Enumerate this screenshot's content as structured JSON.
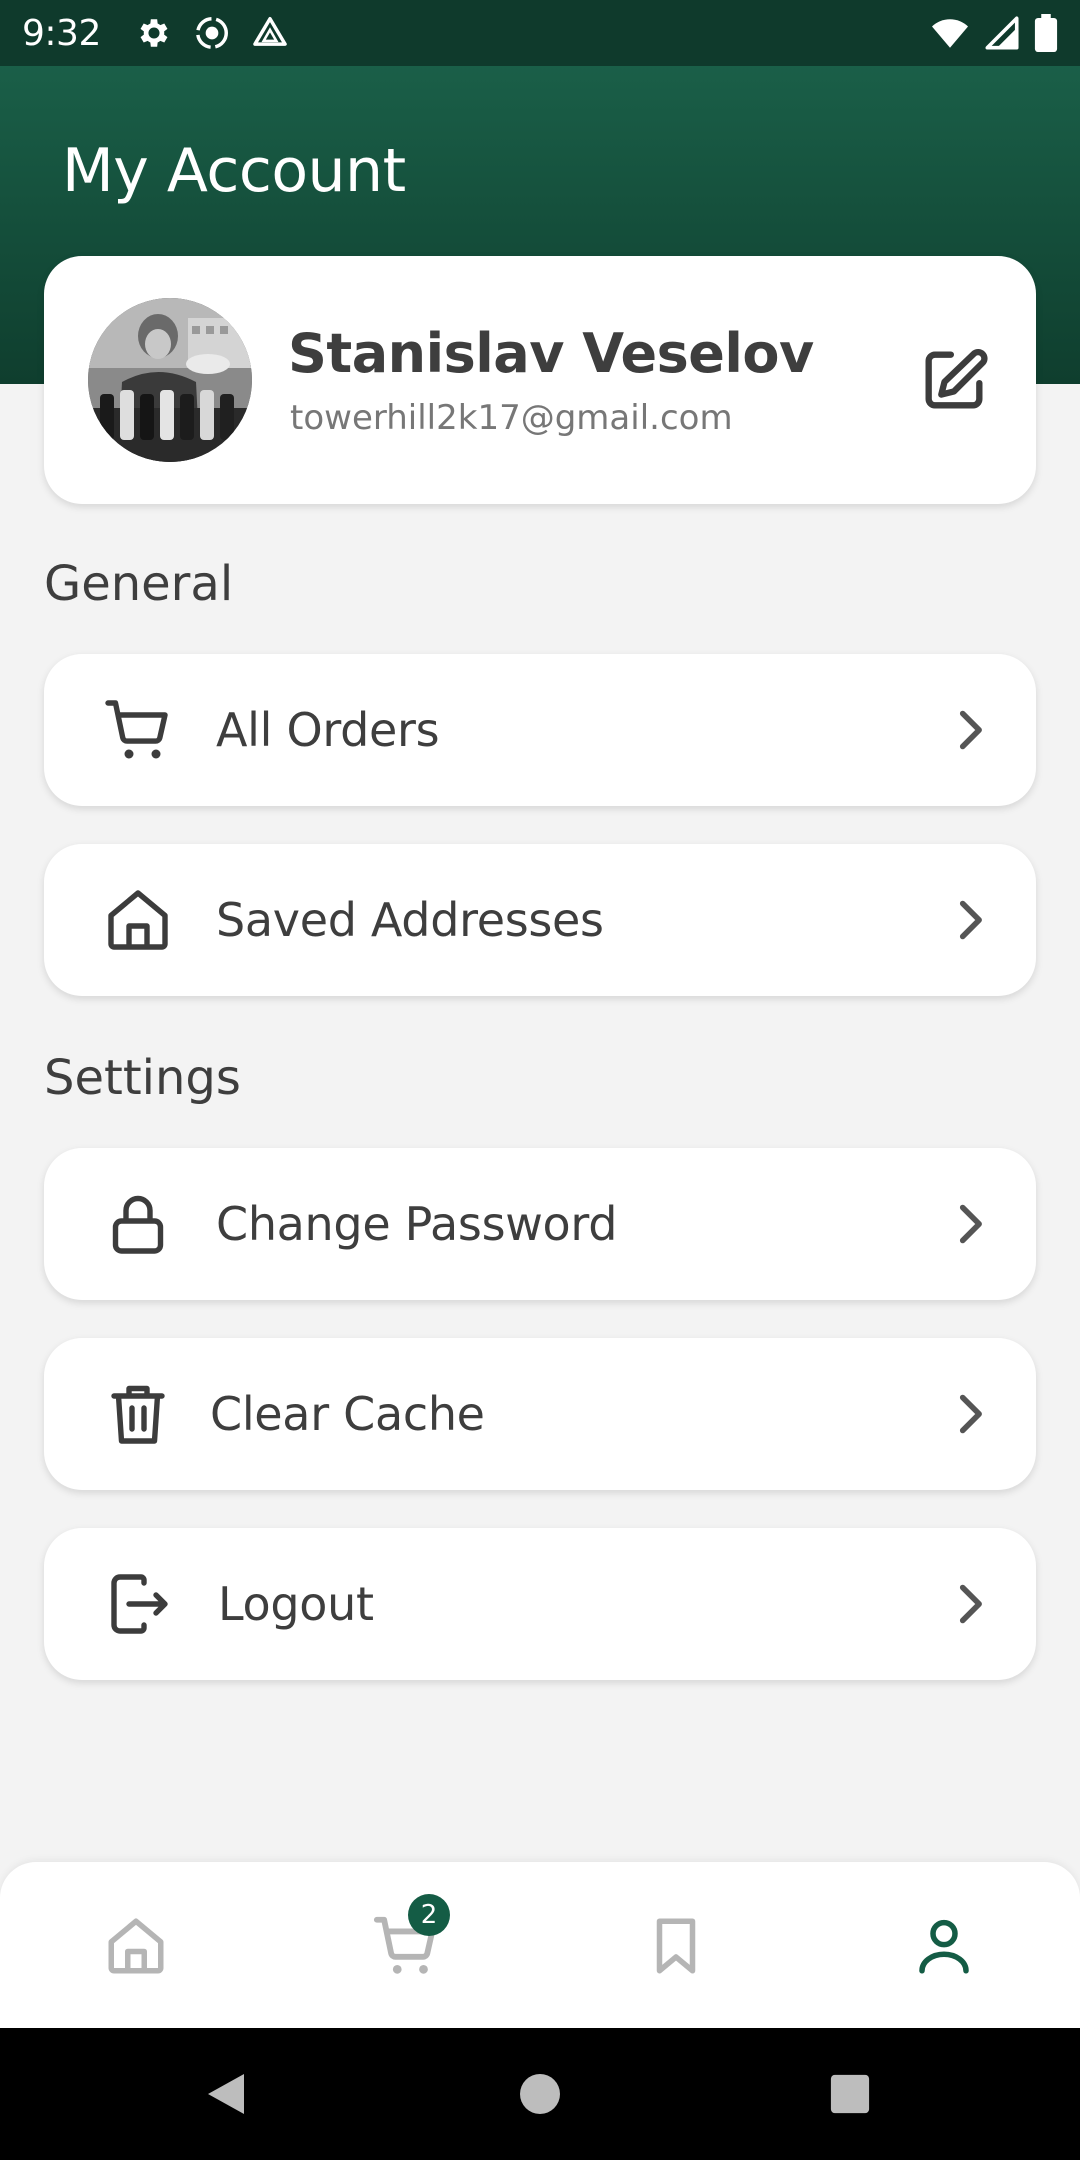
{
  "status_bar": {
    "time": "9:32",
    "left_icons": [
      "gear-icon",
      "record-icon",
      "drive-icon"
    ],
    "right_icons": [
      "wifi-icon",
      "signal-icon",
      "battery-icon"
    ]
  },
  "header": {
    "title": "My Account",
    "color": "#145c45"
  },
  "profile": {
    "name": "Stanislav Veselov",
    "email": "towerhill2k17@gmail.com",
    "avatar_icon": "avatar-photo",
    "edit_icon": "edit-icon"
  },
  "sections": {
    "general": {
      "title": "General",
      "items": [
        {
          "label": "All Orders",
          "icon": "cart-icon"
        },
        {
          "label": "Saved Addresses",
          "icon": "home-icon"
        }
      ]
    },
    "settings": {
      "title": "Settings",
      "items": [
        {
          "label": "Change Password",
          "icon": "lock-icon"
        },
        {
          "label": "Clear Cache",
          "icon": "trash-icon"
        },
        {
          "label": "Logout",
          "icon": "logout-icon"
        }
      ]
    }
  },
  "bottom_nav": {
    "items": [
      {
        "icon": "home-icon",
        "active": false
      },
      {
        "icon": "cart-icon",
        "active": false,
        "badge": "2"
      },
      {
        "icon": "bookmark-icon",
        "active": false
      },
      {
        "icon": "profile-icon",
        "active": true
      }
    ],
    "active_color": "#145c45",
    "inactive_color": "#b5b5b5"
  },
  "system_nav": [
    "back-icon",
    "home-circle-icon",
    "recents-icon"
  ]
}
